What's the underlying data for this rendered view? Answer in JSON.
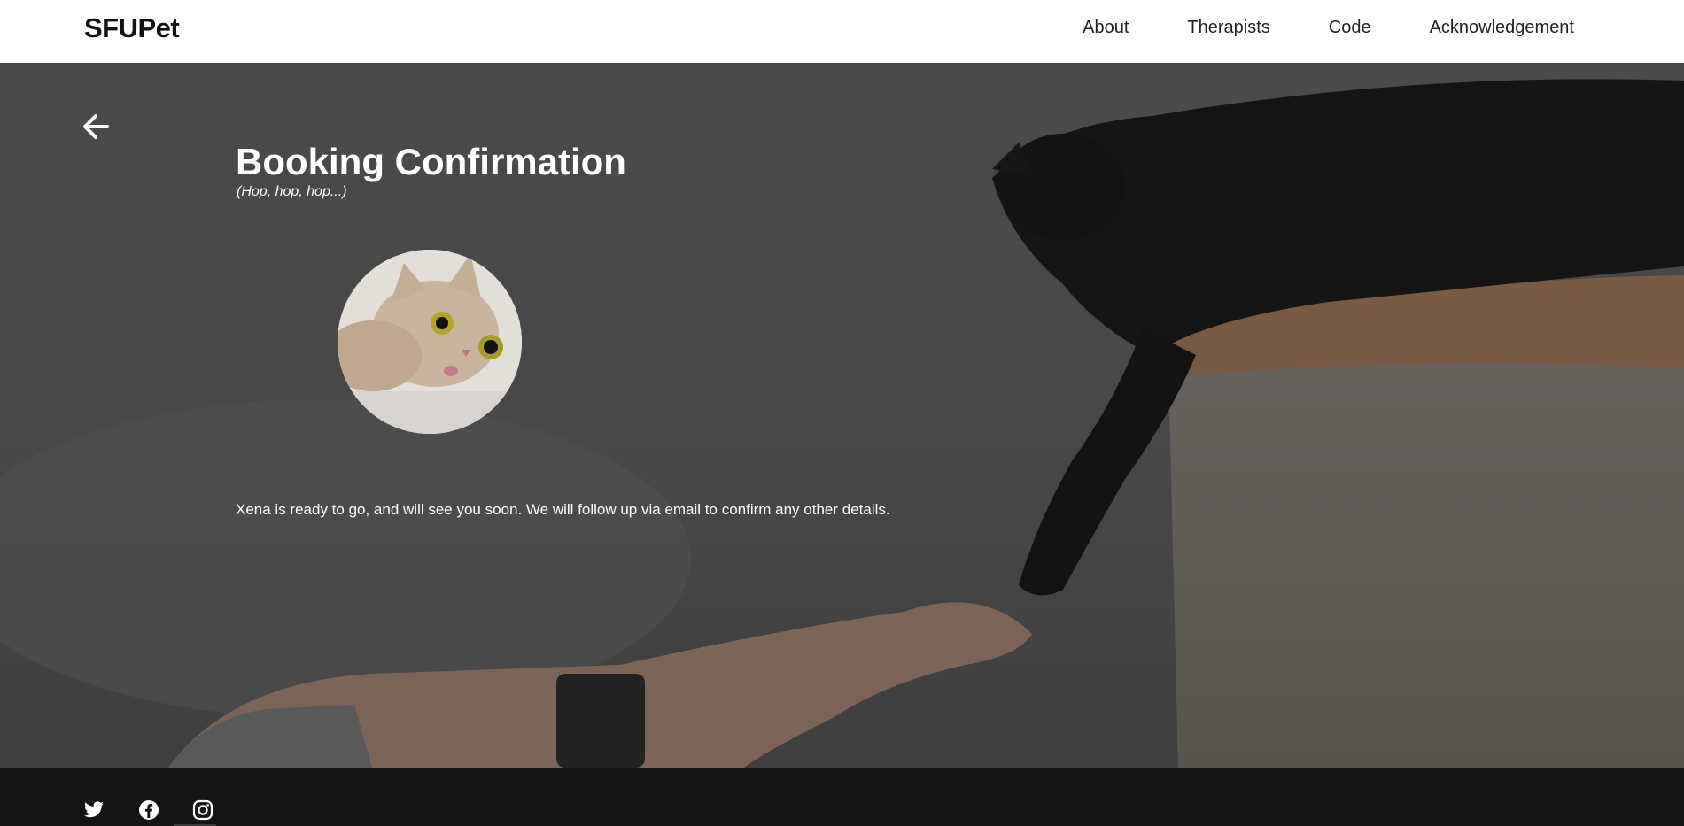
{
  "header": {
    "brand": "SFUPet",
    "nav": [
      {
        "label": "About"
      },
      {
        "label": "Therapists"
      },
      {
        "label": "Code"
      },
      {
        "label": "Acknowledgement"
      }
    ]
  },
  "main": {
    "back_icon": "arrow-left-icon",
    "title": "Booking Confirmation",
    "subtitle": "(Hop, hop, hop...)",
    "message": "Xena is ready to go, and will see you soon. We will follow up via email to confirm any other details."
  },
  "footer": {
    "social": [
      "twitter-icon",
      "facebook-icon",
      "instagram-icon"
    ]
  },
  "colors": {
    "header_bg": "#ffffff",
    "hero_overlay": "#474747",
    "footer_bg": "#141414",
    "text_on_dark": "#ffffff"
  }
}
